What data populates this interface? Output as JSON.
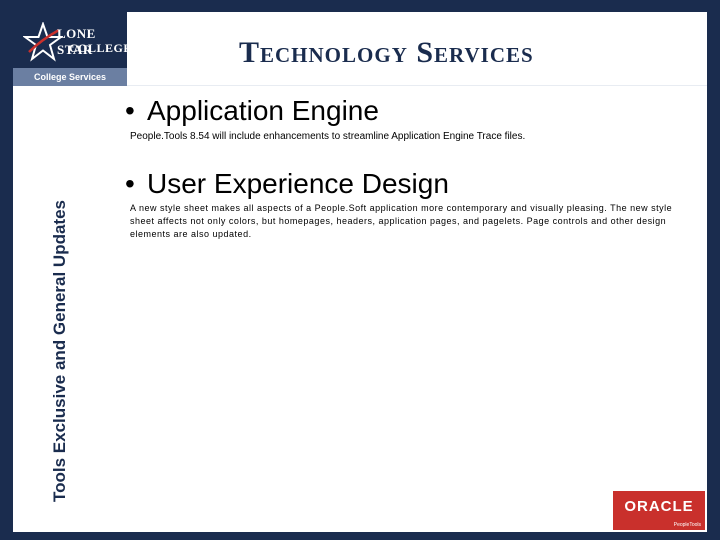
{
  "logo": {
    "line1": "LONE STAR",
    "line2": "COLLEGE",
    "subtitle": "College Services"
  },
  "header": {
    "title": "Technology Services"
  },
  "sidebar": {
    "title": "Tools Exclusive and General Updates"
  },
  "content": {
    "items": [
      {
        "bullet": "•",
        "heading": "Application Engine",
        "text": "People.Tools 8.54 will include enhancements to streamline Application Engine Trace files."
      },
      {
        "bullet": "•",
        "heading": "User Experience Design",
        "text": "A new style sheet makes all aspects of a People.Soft application more contemporary and visually pleasing. The new style sheet affects not only colors, but homepages, headers, application pages, and pagelets. Page controls and other design elements are also updated."
      }
    ]
  },
  "oracle_logo": {
    "word": "ORACLE",
    "sub": "PeopleTools"
  },
  "colors": {
    "navy": "#1a2c4e",
    "oracle_red": "#c9302c"
  }
}
